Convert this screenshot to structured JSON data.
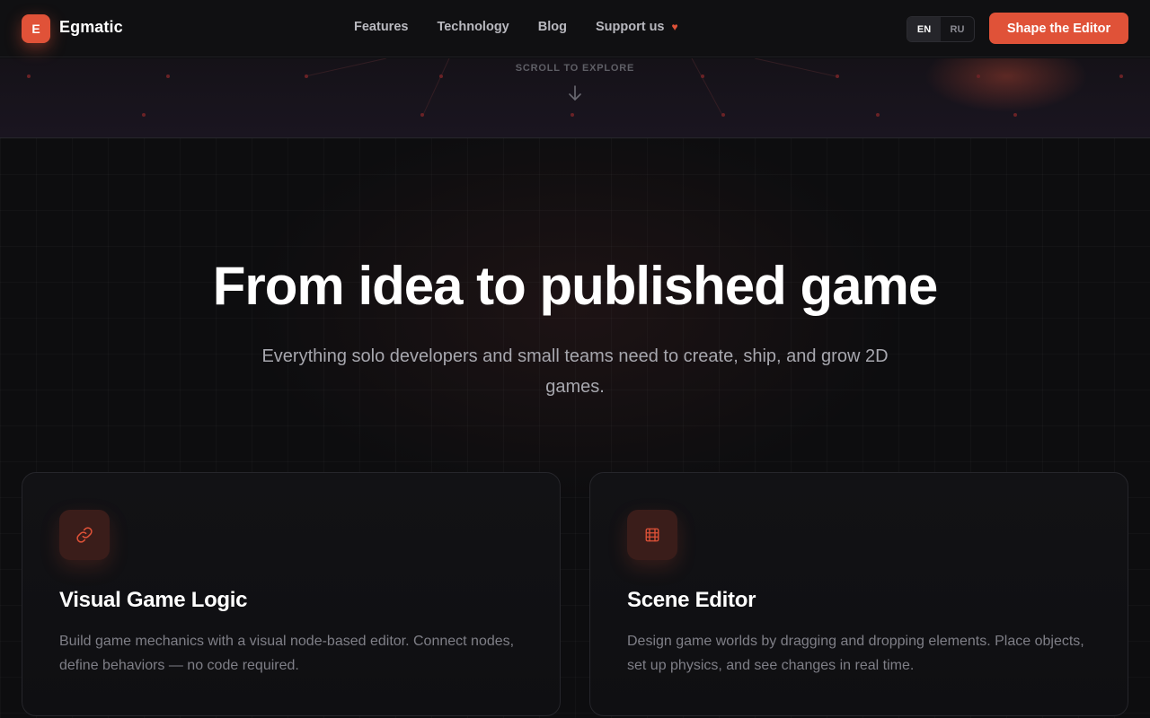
{
  "header": {
    "logo_letter": "E",
    "brand": "Egmatic",
    "nav": [
      {
        "label": "Features"
      },
      {
        "label": "Technology"
      },
      {
        "label": "Blog"
      },
      {
        "label": "Support us"
      }
    ],
    "lang_options": [
      "EN",
      "RU"
    ],
    "lang_active": "EN",
    "cta_label": "Shape the Editor"
  },
  "scroll": {
    "label": "SCROLL TO EXPLORE"
  },
  "hero": {
    "title": "From idea to published game",
    "subtitle": "Everything solo developers and small teams need to create, ship, and grow 2D games."
  },
  "features": [
    {
      "icon": "link-icon",
      "title": "Visual Game Logic",
      "description": "Build game mechanics with a visual node-based editor. Connect nodes, define behaviors — no code required."
    },
    {
      "icon": "film-grid-icon",
      "title": "Scene Editor",
      "description": "Design game worlds by dragging and dropping elements. Place objects, set up physics, and see changes in real time."
    }
  ],
  "colors": {
    "accent": "#e05238",
    "background": "#0d0d0f",
    "text_muted": "#7f7f87"
  }
}
